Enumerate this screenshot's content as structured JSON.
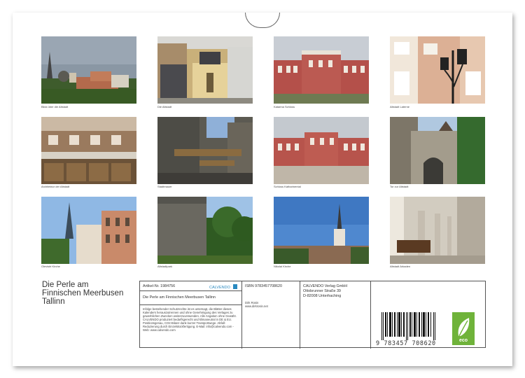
{
  "photos": [
    {
      "caption": "Blick über die Altstadt"
    },
    {
      "caption": "Die Altstadt"
    },
    {
      "caption": "Katarina Schloss"
    },
    {
      "caption": "Altstadt Laterne"
    },
    {
      "caption": "Architektur der Altstadt"
    },
    {
      "caption": "Stadtmauer"
    },
    {
      "caption": "Schloss Katharinental"
    },
    {
      "caption": "Tor zur Altstadt"
    },
    {
      "caption": "Olevisté Kirche"
    },
    {
      "caption": "Altstadtpark"
    },
    {
      "caption": "Nikolai Kirche"
    },
    {
      "caption": "Altstadt Arkaden"
    }
  ],
  "title": {
    "line1": "Die Perle am",
    "line2": "Finnischen Meerbusen",
    "line3": "Tallinn"
  },
  "info": {
    "article": "Artikel-Nr. 1984756",
    "calvendo_brand": "CALVENDO",
    "product_title": "Die Perle am Finnischen Meerbusen Tallinn",
    "legal_text": "Infolge bestehender Schutzrechte ist es untersagt, die Blätter dieses Kalenders herauszutrennen und ohne Genehmigung des Verlages zu gewerblichen Zwecken weiterzuverwenden. Alle Angaben ohne Gewähr. CALVENDO produziert bedarfsgerecht und klimaneutral in DE & EU. Positionsgenau, CO2-Bilanz dank kurzer Transportwege. Abfall-Reduzierung durch Einzelstückfertigung. E-Mail: info@calvendo.com - Web: www.calvendo.com",
    "isbn": "ISBN 9783457708620",
    "author": "Dirk Rosin",
    "author_web": "www.dirkrosin.net",
    "publisher_name": "CALVENDO Verlag GmbH",
    "publisher_street": "Ottobrunner Straße 39",
    "publisher_city": "D-82008 Unterhaching",
    "ean": "9 783457 708620",
    "eco_label": "eco"
  },
  "colors": {
    "eco_green": "#6fb33a",
    "calvendo_blue": "#2a8ac0"
  }
}
